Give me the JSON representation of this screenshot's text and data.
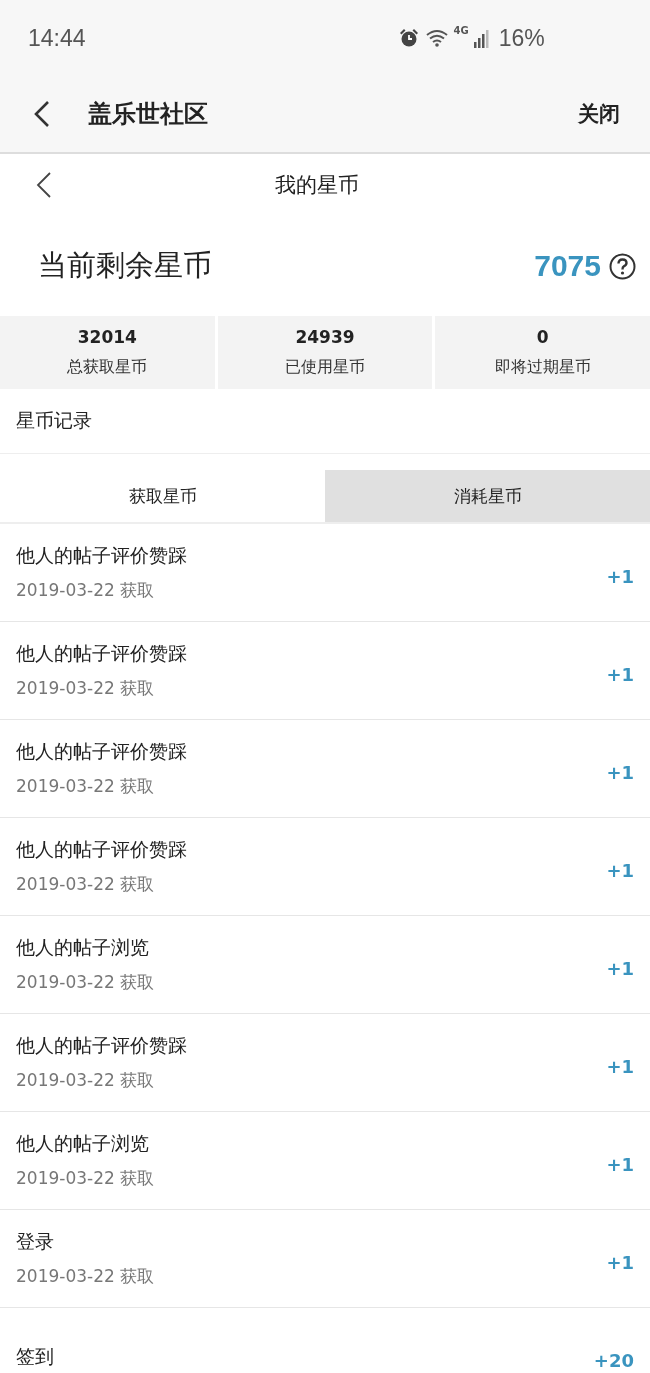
{
  "status_bar": {
    "time": "14:44",
    "network": "4G",
    "battery": "16%"
  },
  "app_bar": {
    "title": "盖乐世社区",
    "close": "关闭"
  },
  "page_header": {
    "title": "我的星币"
  },
  "balance": {
    "label": "当前剩余星币",
    "value": "7075"
  },
  "stats": [
    {
      "value": "32014",
      "label": "总获取星币"
    },
    {
      "value": "24939",
      "label": "已使用星币"
    },
    {
      "value": "0",
      "label": "即将过期星币"
    }
  ],
  "records_title": "星币记录",
  "tabs": [
    {
      "label": "获取星币",
      "selected": true
    },
    {
      "label": "消耗星币",
      "selected": false
    }
  ],
  "records": [
    {
      "title": "他人的帖子评价赞踩",
      "date": "2019-03-22 获取",
      "amount": "+1"
    },
    {
      "title": "他人的帖子评价赞踩",
      "date": "2019-03-22 获取",
      "amount": "+1"
    },
    {
      "title": "他人的帖子评价赞踩",
      "date": "2019-03-22 获取",
      "amount": "+1"
    },
    {
      "title": "他人的帖子评价赞踩",
      "date": "2019-03-22 获取",
      "amount": "+1"
    },
    {
      "title": "他人的帖子浏览",
      "date": "2019-03-22 获取",
      "amount": "+1"
    },
    {
      "title": "他人的帖子评价赞踩",
      "date": "2019-03-22 获取",
      "amount": "+1"
    },
    {
      "title": "他人的帖子浏览",
      "date": "2019-03-22 获取",
      "amount": "+1"
    },
    {
      "title": "登录",
      "date": "2019-03-22 获取",
      "amount": "+1"
    },
    {
      "title": "签到",
      "amount": "+20"
    }
  ]
}
